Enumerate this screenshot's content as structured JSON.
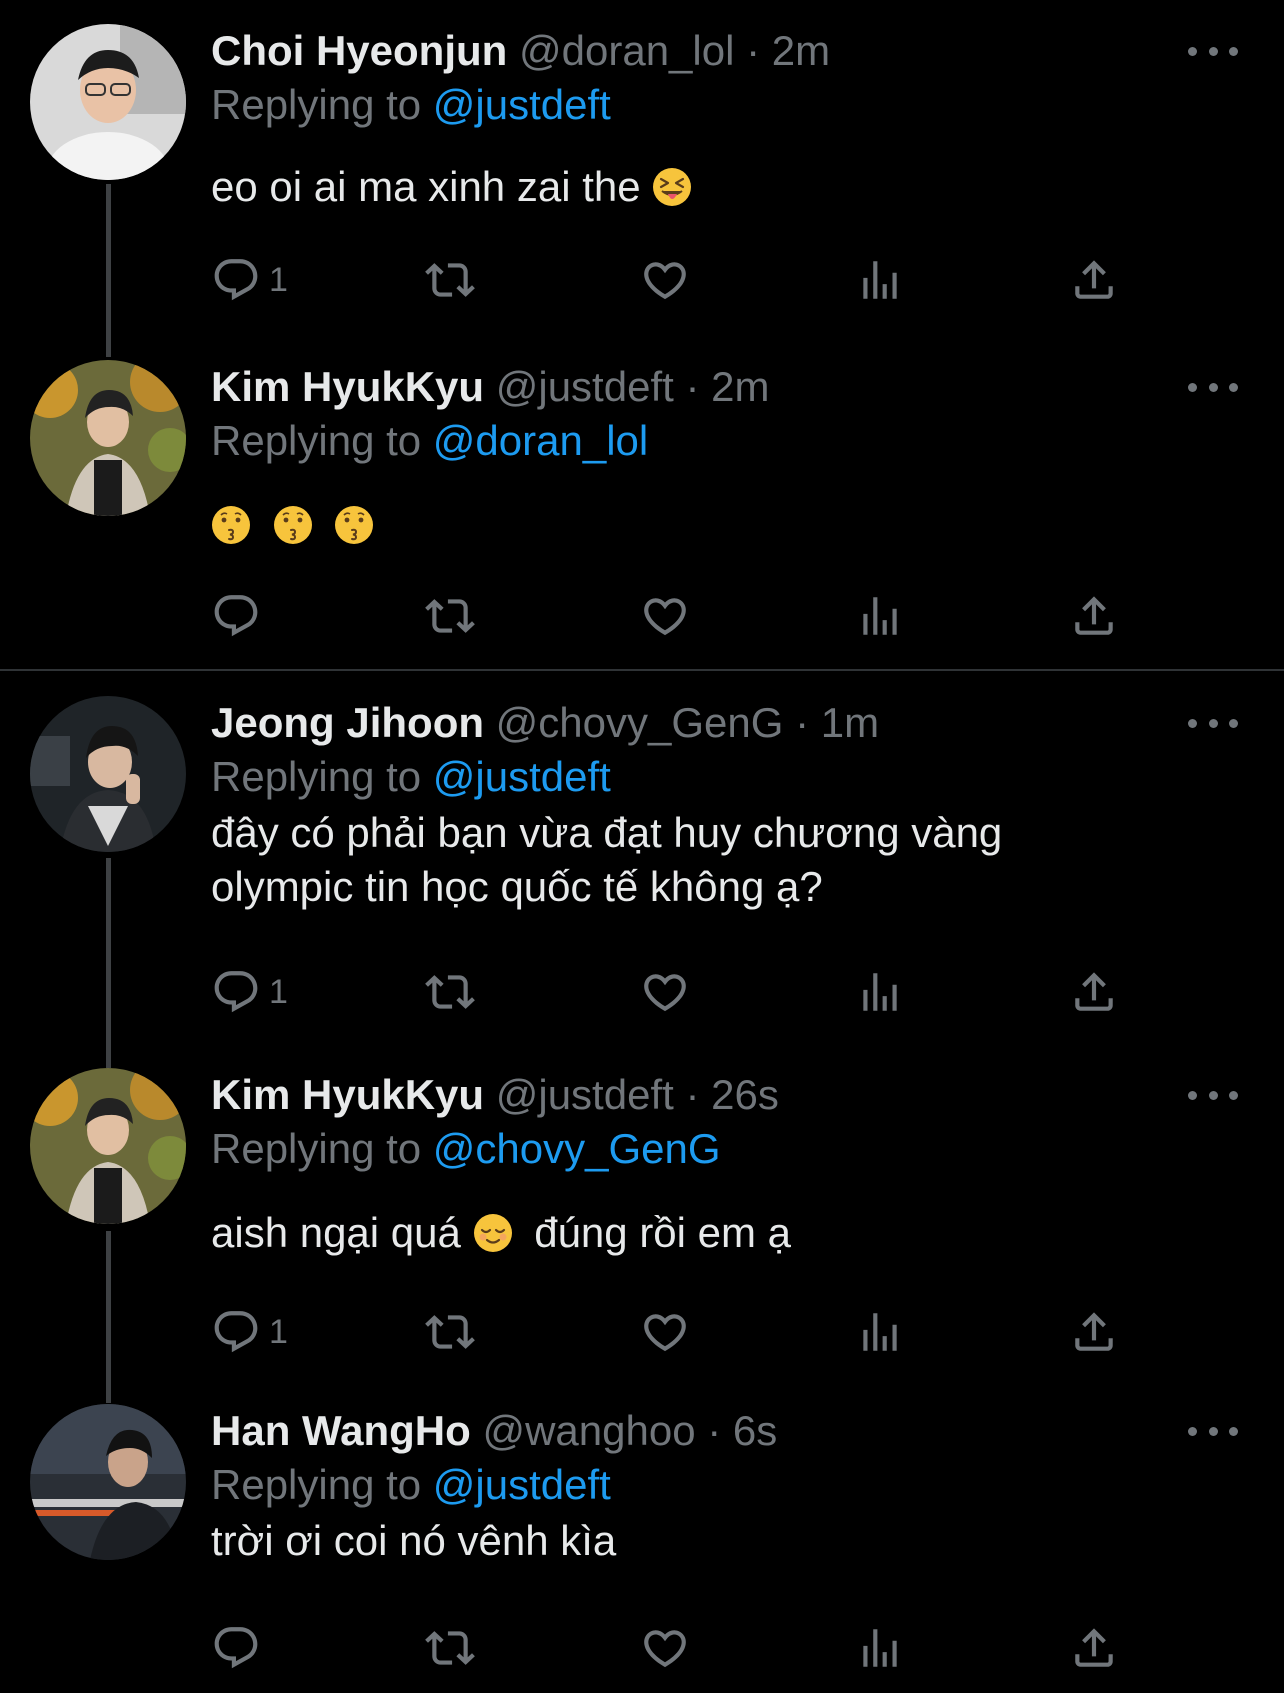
{
  "colors": {
    "background": "#000000",
    "text": "#e7e9ea",
    "muted": "#71767b",
    "link": "#1d9bf0",
    "thread_line": "#3e4144"
  },
  "icons": {
    "reply": "reply-bubble-icon",
    "retweet": "retweet-icon",
    "like": "heart-icon",
    "views": "views-chart-icon",
    "share": "share-icon",
    "more": "more-dots-icon"
  },
  "replying_prefix": "Replying to",
  "tweets": [
    {
      "name": "Choi Hyeonjun",
      "handle": "@doran_lol",
      "sep": "·",
      "time": "2m",
      "reply_to": "@justdeft",
      "text": "eo oi ai ma xinh zai the",
      "emoji": "squinting-face-with-tongue",
      "reply_count": "1"
    },
    {
      "name": "Kim HyukKyu",
      "handle": "@justdeft",
      "sep": "·",
      "time": "2m",
      "reply_to": "@doran_lol",
      "text": "",
      "emoji": "kissing-face x3",
      "reply_count": ""
    },
    {
      "name": "Jeong Jihoon",
      "handle": "@chovy_GenG",
      "sep": "·",
      "time": "1m",
      "reply_to": "@justdeft",
      "text_line1": "đây có phải bạn vừa đạt huy chương vàng",
      "text_line2": "olympic tin học quốc tế không ạ?",
      "reply_count": "1"
    },
    {
      "name": "Kim HyukKyu",
      "handle": "@justdeft",
      "sep": "·",
      "time": "26s",
      "reply_to": "@chovy_GenG",
      "text_before": "aish ngại quá",
      "emoji": "relieved-face",
      "text_after": "đúng rồi em ạ",
      "reply_count": "1"
    },
    {
      "name": "Han WangHo",
      "handle": "@wanghoo",
      "sep": "·",
      "time": "6s",
      "reply_to": "@justdeft",
      "text": "trời ơi coi nó vênh kìa",
      "reply_count": ""
    }
  ]
}
